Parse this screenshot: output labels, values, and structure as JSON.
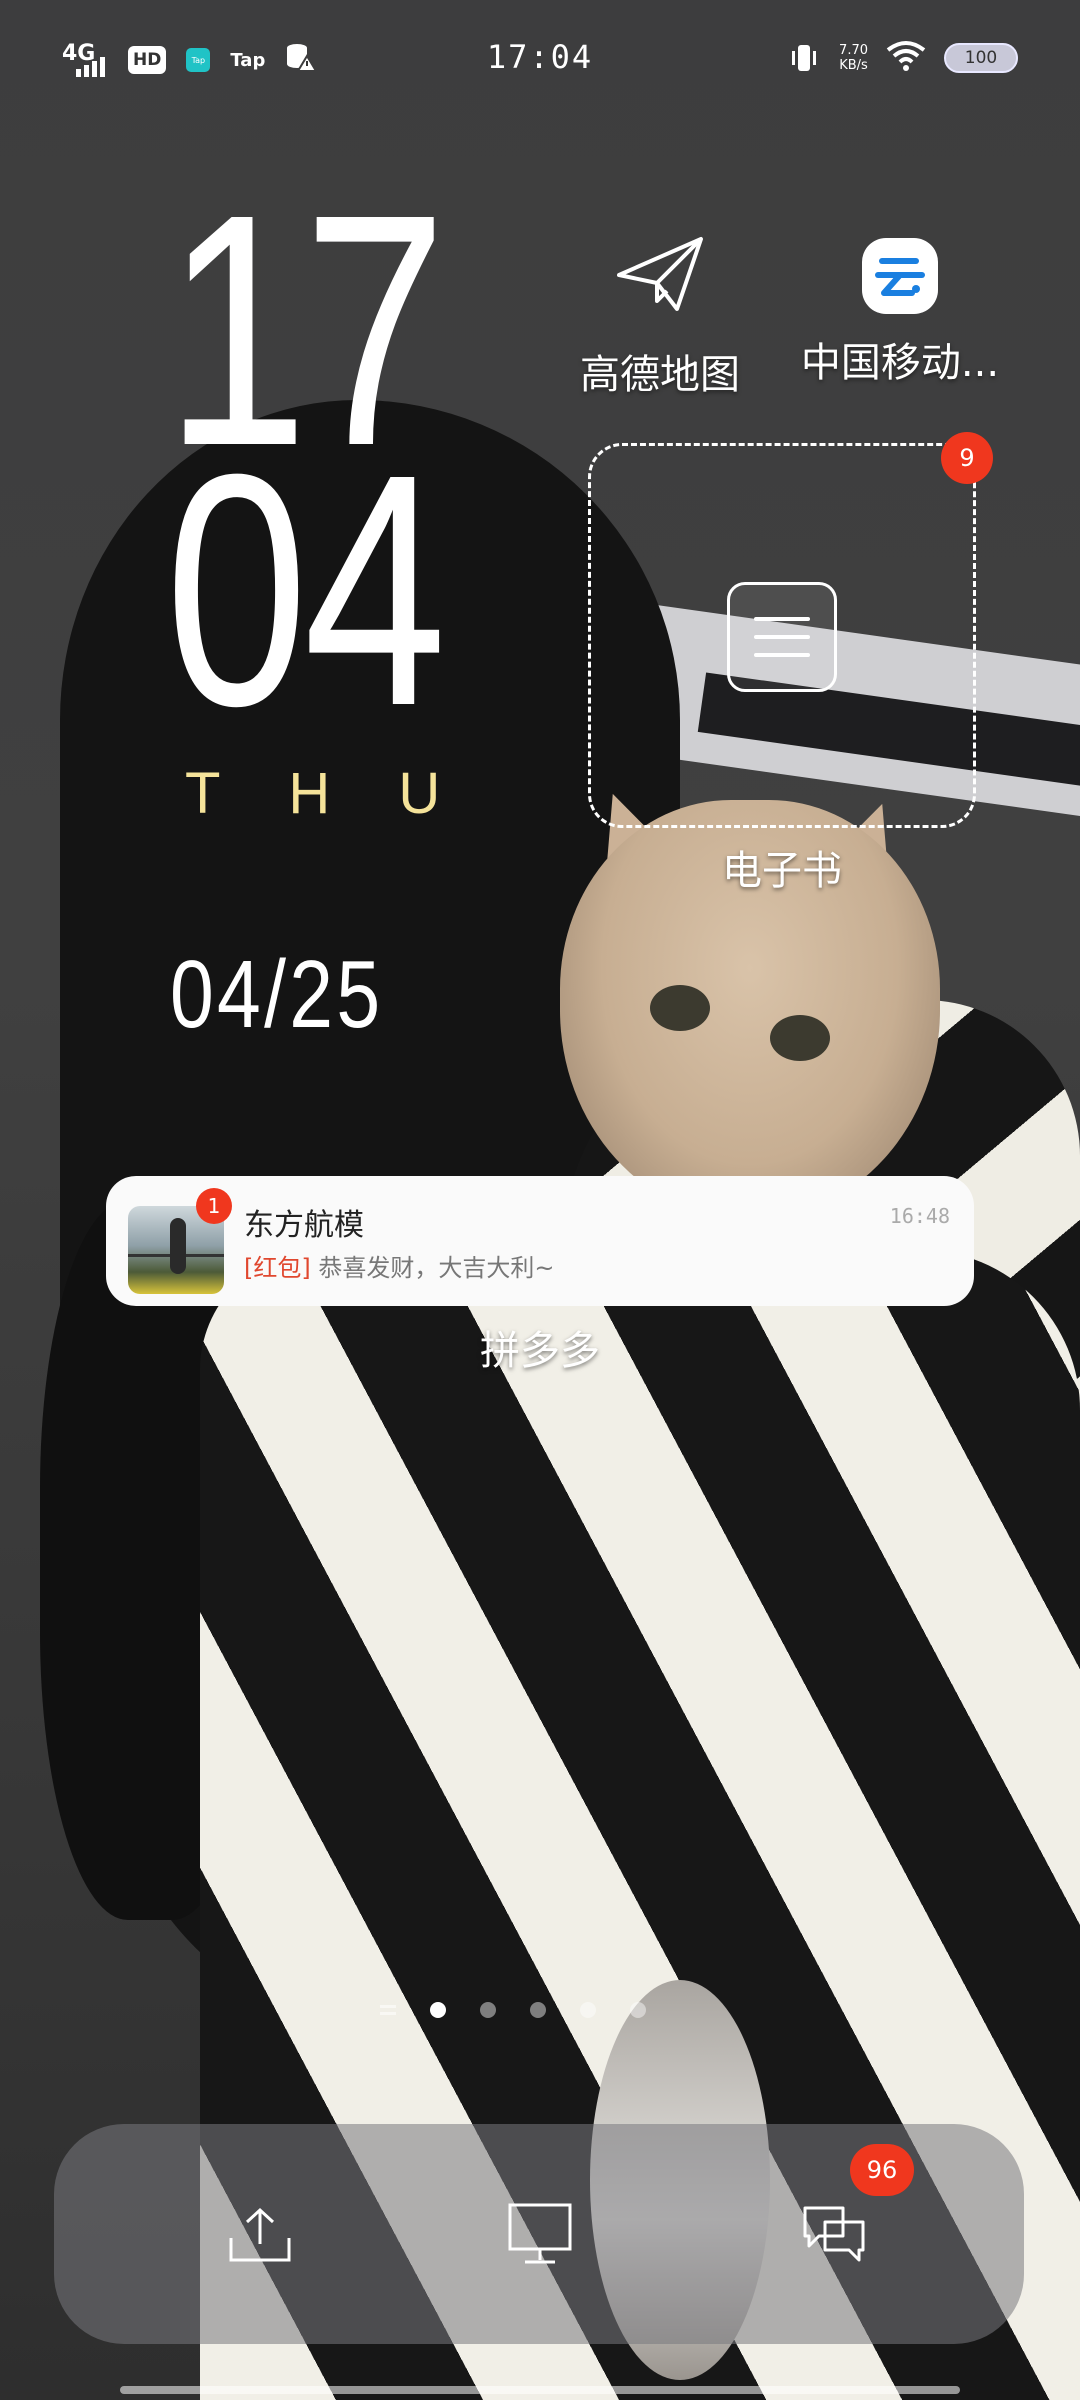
{
  "status_bar": {
    "network": "4G",
    "hd": "HD",
    "tap_small": "Tap",
    "tap_text": "Tap",
    "time": "17:04",
    "speed_value": "7.70",
    "speed_unit": "KB/s",
    "battery": "100"
  },
  "clock": {
    "hours": "17",
    "minutes": "04",
    "weekday": "THU",
    "date": "04/25"
  },
  "apps": {
    "amap_label": "高德地图",
    "china_mobile_label": "中国移动...",
    "folder_label": "电子书",
    "folder_badge": "9",
    "below_notification_label": "拼多多"
  },
  "notification": {
    "app_name": "东方航模",
    "time": "16:48",
    "badge": "1",
    "tag": "[红包]",
    "message": "恭喜发财，大吉大利~"
  },
  "page_indicator": {
    "pages": 5,
    "active_index": 0
  },
  "dock": {
    "messages_badge": "96"
  },
  "colors": {
    "badge": "#f0371e",
    "weekday": "#f5e39a",
    "china_mobile_icon": "#1a7fe0"
  }
}
